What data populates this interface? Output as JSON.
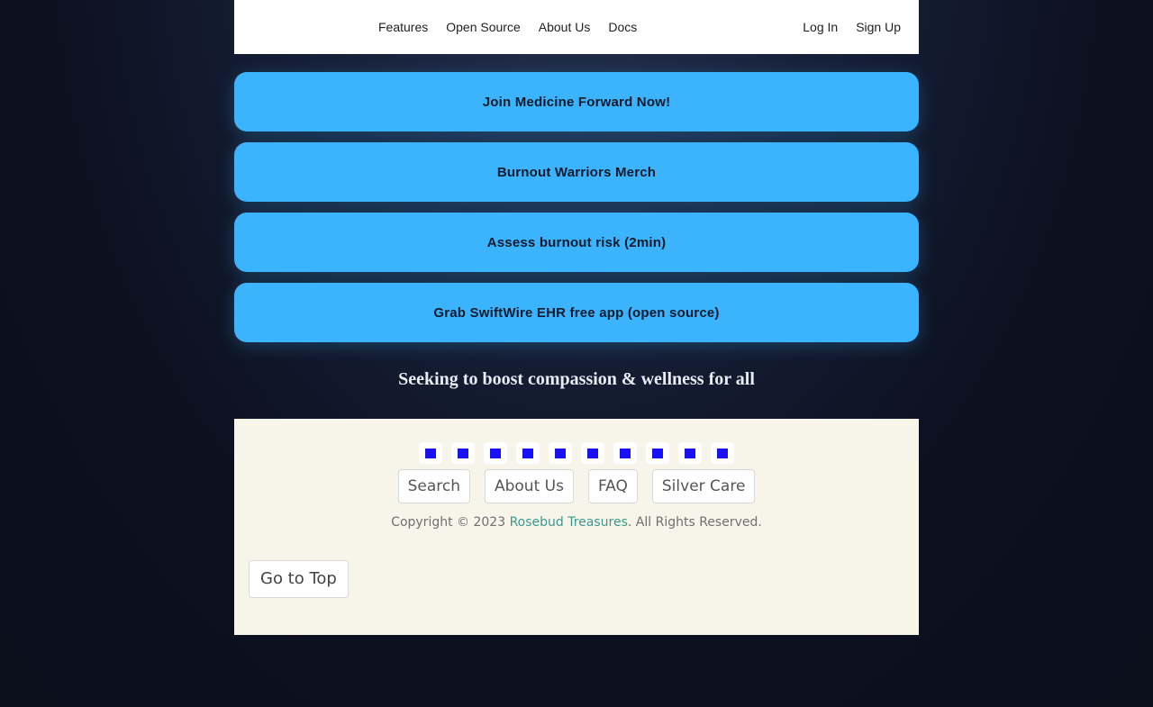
{
  "nav": {
    "links": [
      "Features",
      "Open Source",
      "About Us",
      "Docs"
    ],
    "login": "Log In",
    "signup": "Sign Up"
  },
  "cta_buttons": [
    "Join Medicine Forward Now!",
    "Burnout Warriors Merch",
    "Assess burnout risk (2min)",
    "Grab SwiftWire EHR free app (open source)"
  ],
  "tagline": "Seeking to boost compassion & wellness for all",
  "footer": {
    "social_icons": [
      "social-icon-1",
      "social-icon-2",
      "social-icon-3",
      "social-icon-4",
      "social-icon-5",
      "social-icon-6",
      "social-icon-7",
      "social-icon-8",
      "social-icon-9",
      "social-icon-10"
    ],
    "links": [
      "Search",
      "About Us",
      "FAQ",
      "Silver Care"
    ],
    "copyright_prefix": "Copyright © 2023 ",
    "brand": "Rosebud Treasures",
    "copyright_suffix": ". All Rights Reserved.",
    "go_top": "Go to Top"
  },
  "colors": {
    "cta_background": "#3bb4fd",
    "footer_background": "#f7f5ea",
    "social_icon_fill": "#1a10f5",
    "brand_link": "#3a9a8e"
  }
}
